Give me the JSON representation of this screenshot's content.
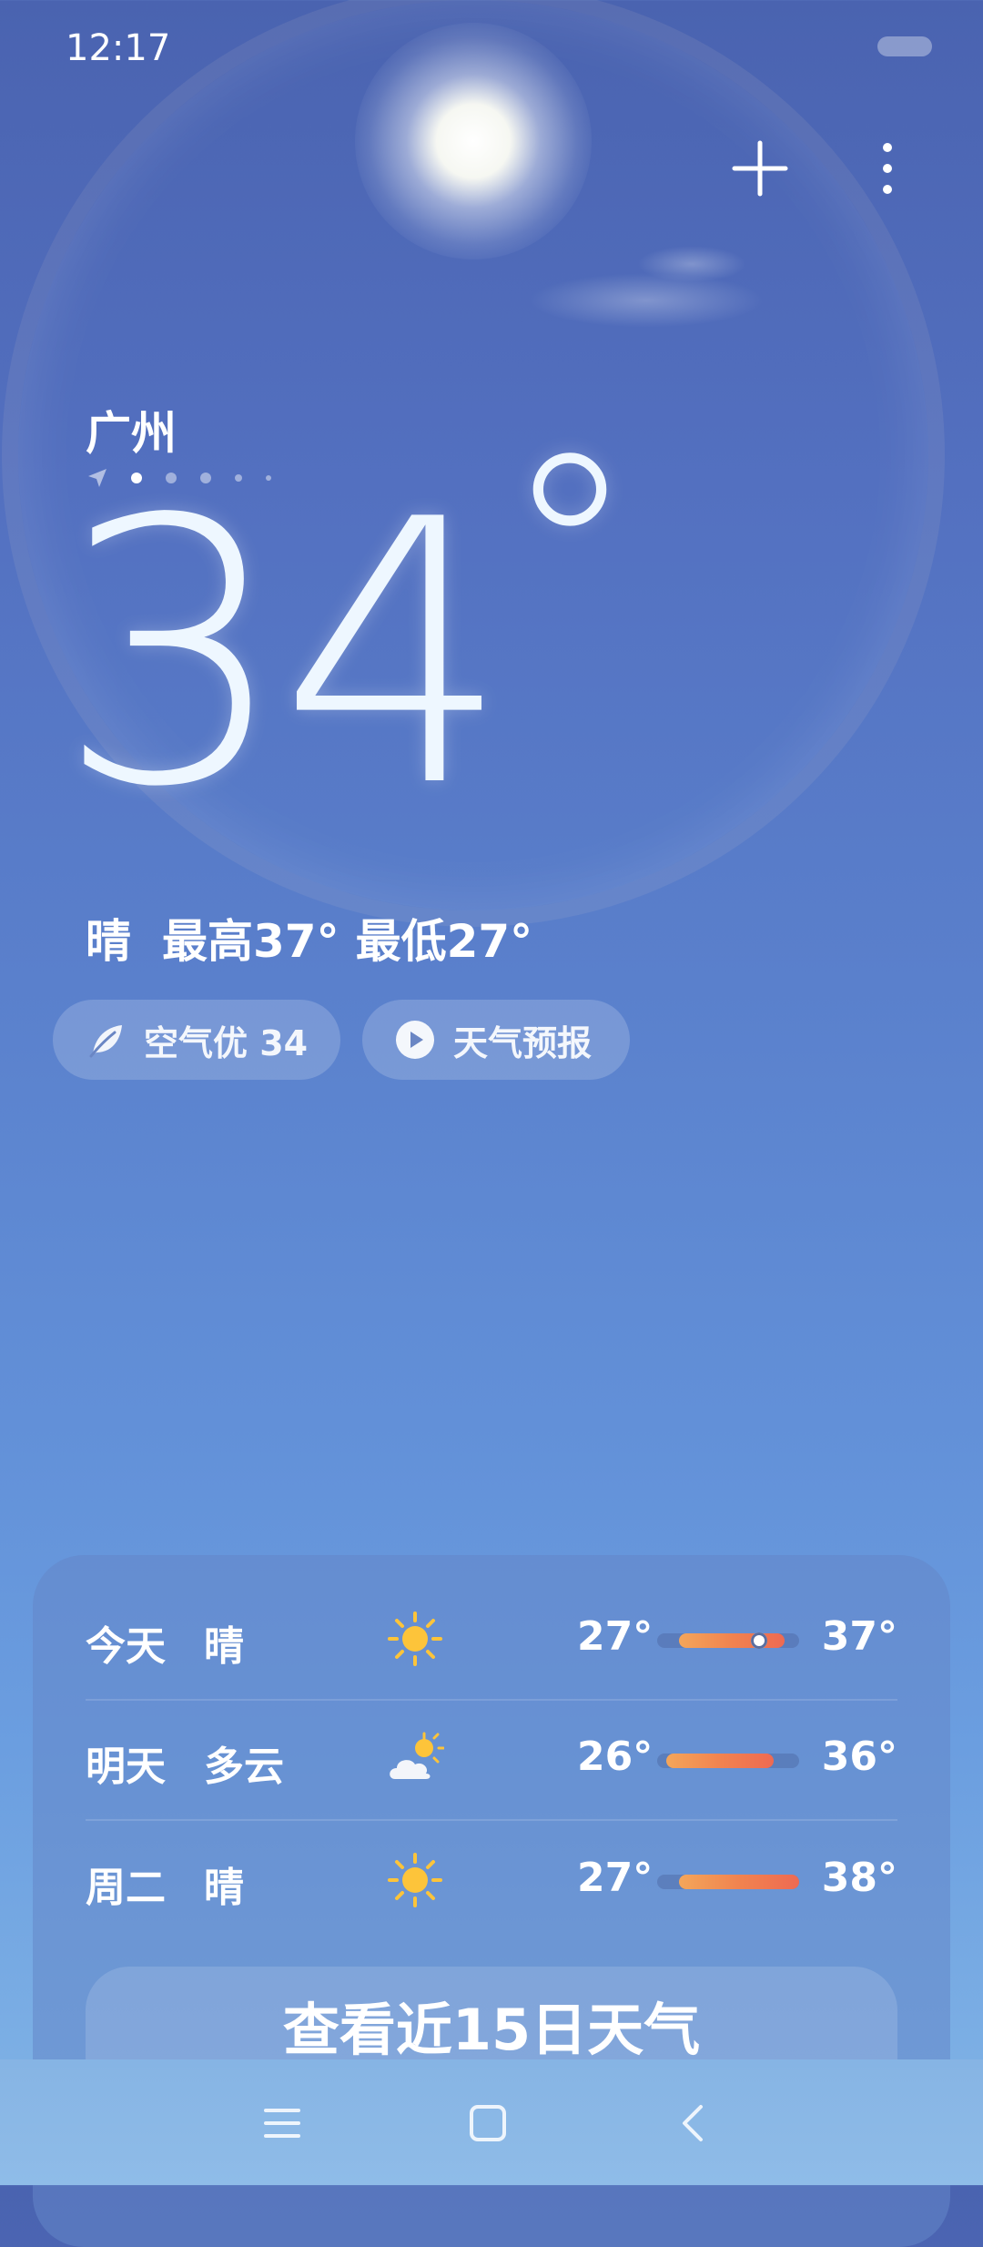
{
  "status_bar": {
    "time": "12:17"
  },
  "header": {
    "add_icon": "plus-icon",
    "more_icon": "more-vertical-icon"
  },
  "location": {
    "city": "广州",
    "page_indicator": {
      "count": 6,
      "active_index": 1,
      "first_is_location_arrow": true
    }
  },
  "current": {
    "temperature": "34",
    "degree_symbol": "°",
    "condition": "晴",
    "high": "最高37°",
    "low": "最低27°"
  },
  "chips": {
    "aqi": {
      "icon": "leaf-icon",
      "label": "空气优 34"
    },
    "forecast": {
      "icon": "play-circle-icon",
      "label": "天气预报"
    }
  },
  "daily": [
    {
      "day": "今天",
      "condition": "晴",
      "icon": "sun-icon",
      "low": "27°",
      "high": "37°",
      "bar_start": 0.1,
      "bar_end": 0.9,
      "current_marker": 0.72
    },
    {
      "day": "明天",
      "condition": "多云",
      "icon": "partly-cloudy-icon",
      "low": "26°",
      "high": "36°",
      "bar_start": 0.05,
      "bar_end": 0.82
    },
    {
      "day": "周二",
      "condition": "晴",
      "icon": "sun-icon",
      "low": "27°",
      "high": "38°",
      "bar_start": 0.1,
      "bar_end": 1.0
    }
  ],
  "view_more": {
    "label": "查看近15日天气"
  },
  "nav_bar": {
    "menu_icon": "menu-icon",
    "home_icon": "home-square-icon",
    "back_icon": "back-chevron-icon"
  },
  "colors": {
    "bar_gradient_start": "#f4a65a",
    "bar_gradient_end": "#ee6a52",
    "sun": "#fdc43a"
  }
}
